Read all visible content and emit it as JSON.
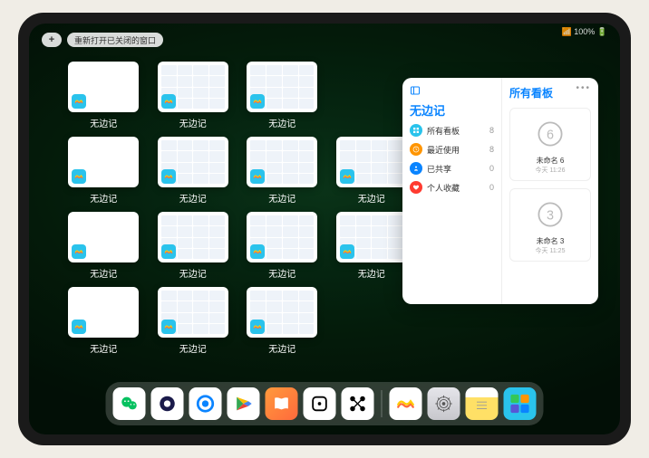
{
  "status": "📶 100% 🔋",
  "topbar": {
    "plus": "+",
    "reopen": "重新打开已关闭的窗口"
  },
  "card_label": "无边记",
  "cards": [
    {
      "type": "blank"
    },
    {
      "type": "grid"
    },
    {
      "type": "grid"
    },
    {
      "type": "blank",
      "row": 2
    },
    {
      "type": "grid",
      "row": 2
    },
    {
      "type": "grid",
      "row": 2
    },
    {
      "type": "grid",
      "row": 2
    },
    {
      "type": "blank",
      "row": 3
    },
    {
      "type": "grid",
      "row": 3
    },
    {
      "type": "grid",
      "row": 3
    },
    {
      "type": "grid",
      "row": 3
    },
    {
      "type": "blank",
      "row": 4
    },
    {
      "type": "grid",
      "row": 4
    },
    {
      "type": "grid",
      "row": 4
    }
  ],
  "panel": {
    "title": "无边记",
    "items": [
      {
        "icon": "grid",
        "color": "#2ac3ec",
        "label": "所有看板",
        "count": "8"
      },
      {
        "icon": "clock",
        "color": "#ff9500",
        "label": "最近使用",
        "count": "8"
      },
      {
        "icon": "share",
        "color": "#0a84ff",
        "label": "已共享",
        "count": "0"
      },
      {
        "icon": "heart",
        "color": "#ff3b30",
        "label": "个人收藏",
        "count": "0"
      }
    ],
    "right_title": "所有看板",
    "boards": [
      {
        "name": "未命名 6",
        "date": "今天 11:26",
        "sketch": "6"
      },
      {
        "name": "未命名 3",
        "date": "今天 11:25",
        "sketch": "3"
      }
    ]
  },
  "dock": [
    {
      "name": "wechat",
      "bg": "#fff"
    },
    {
      "name": "quark",
      "bg": "#fff"
    },
    {
      "name": "qqbrowser",
      "bg": "#fff"
    },
    {
      "name": "play",
      "bg": "#fff"
    },
    {
      "name": "books",
      "bg": "linear-gradient(135deg,#ff9a3c,#ff6a3c)"
    },
    {
      "name": "dice",
      "bg": "#fff"
    },
    {
      "name": "nodes",
      "bg": "#fff"
    },
    {
      "name": "freeform",
      "bg": "#fff"
    },
    {
      "name": "settings",
      "bg": "linear-gradient(#e5e5ea,#c7c7cc)"
    },
    {
      "name": "notes",
      "bg": "linear-gradient(#fff 30%,#ffe066 30%)"
    },
    {
      "name": "folder",
      "bg": "#2ac3ec",
      "small": true
    }
  ]
}
